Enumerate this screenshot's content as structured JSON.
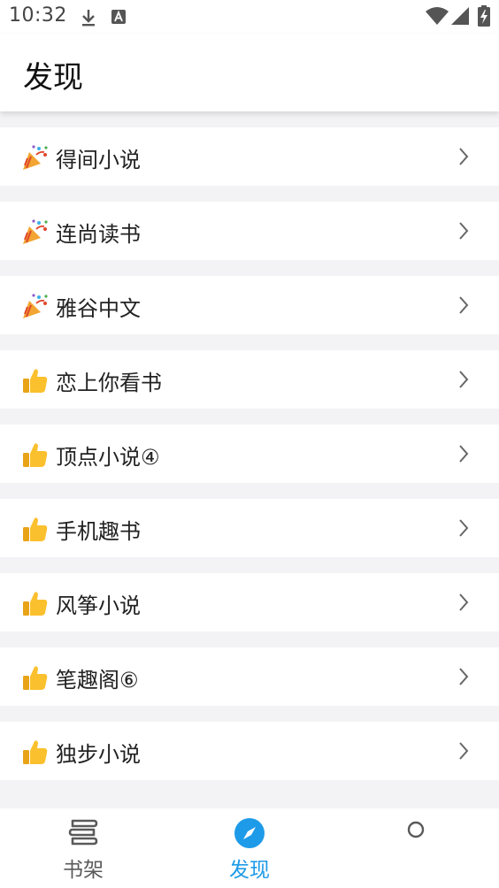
{
  "status_bar": {
    "time": "10:32",
    "icons": [
      "download-icon",
      "a-letter-notification-icon",
      "wifi-icon",
      "signal-icon",
      "battery-charging-icon"
    ]
  },
  "header": {
    "title": "发现"
  },
  "list": {
    "items": [
      {
        "emoji": "party-popper-icon",
        "label": "得间小说"
      },
      {
        "emoji": "party-popper-icon",
        "label": "连尚读书"
      },
      {
        "emoji": "party-popper-icon",
        "label": "雅谷中文"
      },
      {
        "emoji": "thumbs-up-icon",
        "label": "恋上你看书"
      },
      {
        "emoji": "thumbs-up-icon",
        "label": "顶点小说④"
      },
      {
        "emoji": "thumbs-up-icon",
        "label": "手机趣书"
      },
      {
        "emoji": "thumbs-up-icon",
        "label": "风筝小说"
      },
      {
        "emoji": "thumbs-up-icon",
        "label": "笔趣阁⑥"
      },
      {
        "emoji": "thumbs-up-icon",
        "label": "独步小说"
      }
    ]
  },
  "bottom_nav": {
    "items": [
      {
        "label": "书架",
        "icon": "bookshelf-icon",
        "active": false
      },
      {
        "label": "发现",
        "icon": "compass-icon",
        "active": true
      },
      {
        "label": "",
        "icon": "circle-icon",
        "active": false
      }
    ]
  },
  "colors": {
    "accent": "#1e9be8",
    "inactive": "#5a5a5a",
    "background": "#f3f2f4"
  }
}
